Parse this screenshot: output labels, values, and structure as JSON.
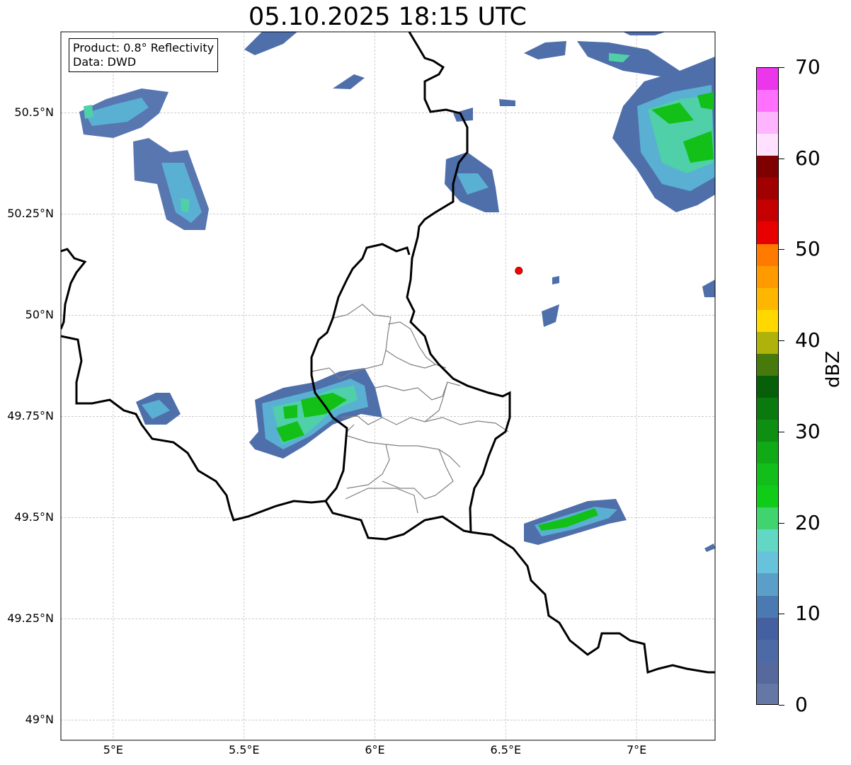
{
  "title": "05.10.2025 18:15 UTC",
  "info": {
    "product_line": "Product: 0.8° Reflectivity",
    "data_line": "Data: DWD"
  },
  "map": {
    "lon_range": [
      4.8,
      7.3
    ],
    "lat_range": [
      48.95,
      50.7
    ],
    "lon_ticks": [
      {
        "value": 5.0,
        "label": "5°E"
      },
      {
        "value": 5.5,
        "label": "5.5°E"
      },
      {
        "value": 6.0,
        "label": "6°E"
      },
      {
        "value": 6.5,
        "label": "6.5°E"
      },
      {
        "value": 7.0,
        "label": "7°E"
      }
    ],
    "lat_ticks": [
      {
        "value": 49.0,
        "label": "49°N"
      },
      {
        "value": 49.25,
        "label": "49.25°N"
      },
      {
        "value": 49.5,
        "label": "49.5°N"
      },
      {
        "value": 49.75,
        "label": "49.75°N"
      },
      {
        "value": 50.0,
        "label": "50°N"
      },
      {
        "value": 50.25,
        "label": "50.25°N"
      },
      {
        "value": 50.5,
        "label": "50.5°N"
      }
    ],
    "gridlines": true,
    "radar_site": {
      "lon": 6.55,
      "lat": 50.11,
      "color": "#ff0000"
    }
  },
  "colorbar": {
    "unit": "dBZ",
    "min": 0,
    "max": 70,
    "tick_labels": [
      "0",
      "10",
      "20",
      "30",
      "40",
      "50",
      "60",
      "70"
    ],
    "colors": [
      "#6477a6",
      "#56699e",
      "#4d6aa6",
      "#4560a0",
      "#4b7ab3",
      "#5b9fc8",
      "#67c3dc",
      "#62d8c4",
      "#40d470",
      "#10cc18",
      "#12be1a",
      "#10aa16",
      "#0e8e12",
      "#0a7a0e",
      "#075f0a",
      "#477a0a",
      "#b0b20c",
      "#ffd800",
      "#ffb600",
      "#ff9a00",
      "#ff7b00",
      "#e60000",
      "#c40000",
      "#a00000",
      "#7e0000",
      "#ffe0ff",
      "#ffb4ff",
      "#ff70ff",
      "#ec36ec"
    ]
  },
  "echo_colors": {
    "weak": "#4f6fab",
    "light": "#5ab0d2",
    "moderate": "#4fd0a8",
    "strong": "#12c018"
  }
}
